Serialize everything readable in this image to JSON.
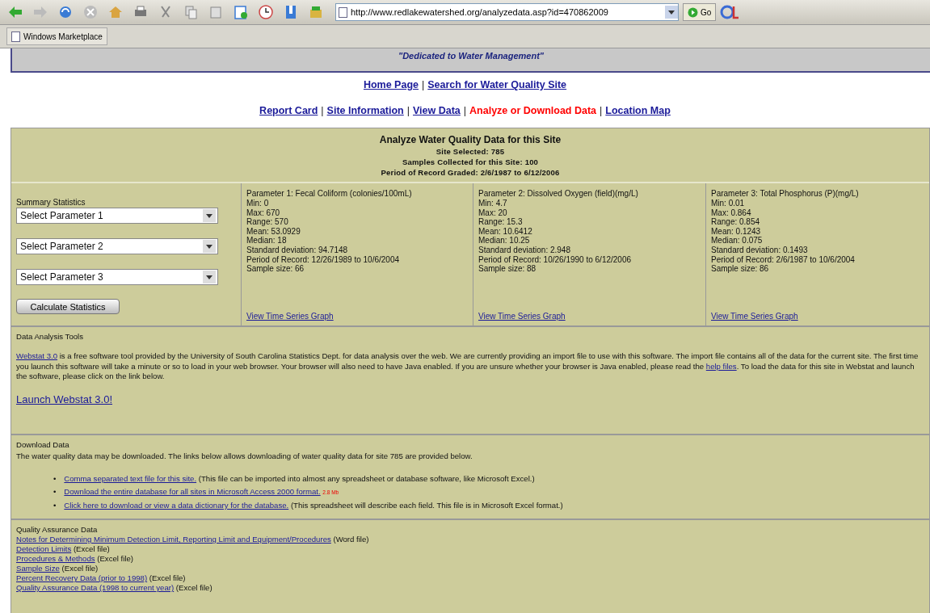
{
  "browser": {
    "url": "http://www.redlakewatershed.org/analyzedata.asp?id=470862009",
    "go_button": "Go",
    "bookmarks": [
      {
        "label": "Windows Marketplace"
      }
    ]
  },
  "banner": {
    "tagline": "\"Dedicated to Water Management\""
  },
  "nav_primary": {
    "separator": "|",
    "links": [
      {
        "label": "Home Page",
        "selected": false
      },
      {
        "label": "Search for Water Quality Site",
        "selected": false
      }
    ]
  },
  "nav_secondary": {
    "separator": "|",
    "links": [
      {
        "label": "Report Card",
        "selected": false
      },
      {
        "label": "Site Information",
        "selected": false
      },
      {
        "label": "View Data",
        "selected": false
      },
      {
        "label": "Analyze or Download Data",
        "selected": true
      },
      {
        "label": "Location Map",
        "selected": false
      }
    ]
  },
  "header": {
    "title": "Analyze Water Quality Data for this Site",
    "lines": [
      "Site Selected: 785",
      "Samples Collected for this Site: 100",
      "Period of Record Graded: 2/6/1987 to 6/12/2006"
    ]
  },
  "summary": {
    "label": "Summary Statistics",
    "selects": [
      "Select Parameter 1",
      "Select Parameter 2",
      "Select Parameter 3"
    ],
    "button": "Calculate Statistics"
  },
  "parameters": [
    {
      "title": "Parameter 1: Fecal Coliform (colonies/100mL)",
      "stats": [
        "Min: 0",
        "Max: 670",
        "Range: 570",
        "Mean: 53.0929",
        "Median: 18",
        "Standard deviation: 94.7148",
        "Period of Record: 12/26/1989 to 10/6/2004",
        "Sample size: 66"
      ],
      "link": "View Time Series Graph"
    },
    {
      "title": "Parameter 2: Dissolved Oxygen (field)(mg/L)",
      "stats": [
        "Min: 4.7",
        "Max: 20",
        "Range: 15.3",
        "Mean: 10.6412",
        "Median: 10.25",
        "Standard deviation: 2.948",
        "Period of Record: 10/26/1990 to 6/12/2006",
        "Sample size: 88"
      ],
      "link": "View Time Series Graph"
    },
    {
      "title": "Parameter 3: Total Phosphorus (P)(mg/L)",
      "stats": [
        "Min: 0.01",
        "Max: 0.864",
        "Range: 0.854",
        "Mean: 0.1243",
        "Median: 0.075",
        "Standard deviation: 0.1493",
        "Period of Record: 2/6/1987 to 10/6/2004",
        "Sample size: 86"
      ],
      "link": "View Time Series Graph"
    }
  ],
  "analysis": {
    "heading": "Data Analysis Tools",
    "paragraph": [
      {
        "kind": "link",
        "text": "Webstat 3.0"
      },
      {
        "kind": "text",
        "text": " is a free software tool provided by the University of South Carolina Statistics Dept. for data analysis over the web.  We are currently providing an import file to use with this software.  The import file contains all of the data for the current site.  The first time you launch this software will take a minute or so to load in your web browser.  Your browser will also need to have Java enabled.  If you are unsure whether your browser is Java enabled, please read the "
      },
      {
        "kind": "link",
        "text": "help files"
      },
      {
        "kind": "text",
        "text": ".  To load the data for this site in Webstat and launch the software, please click on the link below."
      }
    ],
    "launch_link": "Launch Webstat 3.0!"
  },
  "download": {
    "heading": "Download Data",
    "bullet": "•",
    "intro": "The water quality data may be downloaded.  The links below allows downloading of water quality data for site 785 are provided below.",
    "items": [
      {
        "link": "Comma separated text file for this site.",
        "note": "(This file can be imported into almost any spreadsheet or database software, like Microsoft Excel.)"
      },
      {
        "link": "Download the entire database for all sites in Microsoft Access 2000 format.",
        "size": "2.8 Mb"
      },
      {
        "link": "Click here to download or view a data dictionary for the database.",
        "note": "(This spreadsheet will describe each field.  This file is in Microsoft Excel format.)"
      }
    ]
  },
  "quality": {
    "heading": "Quality Assurance Data",
    "items": [
      {
        "link": "Notes for Determining Minimum Detection Limit, Reporting Limit and Equipment/Procedures",
        "note": "(Word file)"
      },
      {
        "link": "Detection Limits",
        "note": "(Excel file)"
      },
      {
        "link": "Procedures & Methods",
        "note": "(Excel file)"
      },
      {
        "link": "Sample Size",
        "note": "(Excel file)"
      },
      {
        "link": "Percent Recovery Data (prior to 1998)",
        "note": "(Excel file)"
      },
      {
        "link": "Quality Assurance Data (1998 to current year)",
        "note": "(Excel file)"
      }
    ]
  }
}
